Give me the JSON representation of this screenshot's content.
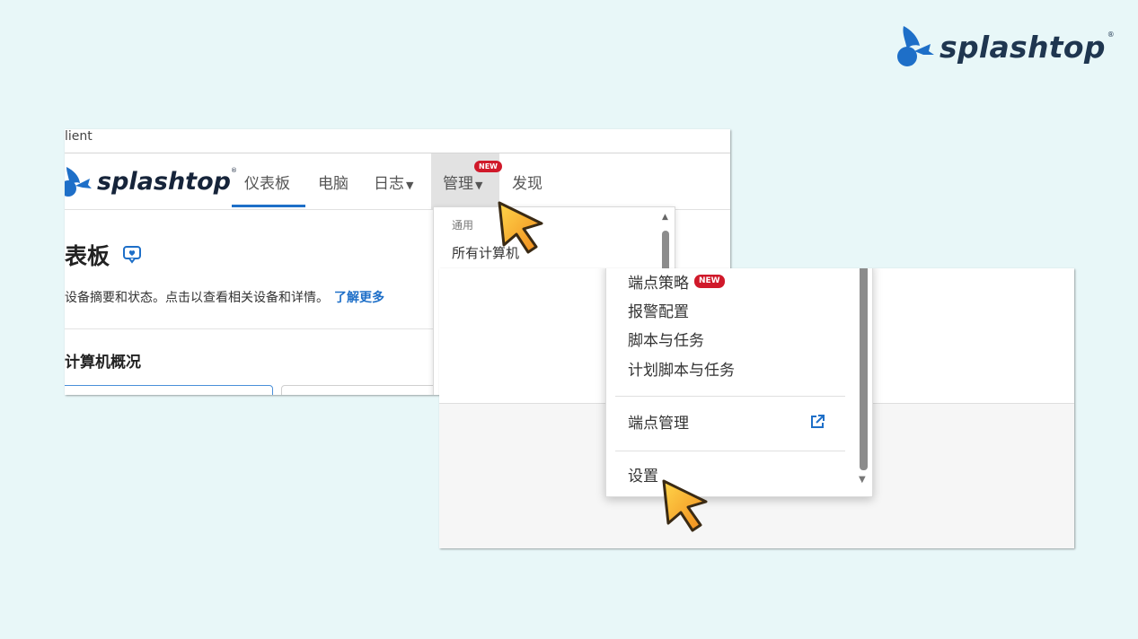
{
  "brand": {
    "name": "splashtop",
    "reg": "®"
  },
  "shot1": {
    "window_title": "lient",
    "nav": {
      "logo_text": "splashtop",
      "logo_reg": "®",
      "items": [
        {
          "label": "仪表板"
        },
        {
          "label": "电脑"
        },
        {
          "label": "日志"
        },
        {
          "label": "管理"
        },
        {
          "label": "发现"
        }
      ],
      "new_badge": "NEW"
    },
    "page": {
      "title": "表板",
      "description": "设备摘要和状态。点击以查看相关设备和详情。",
      "learn_more": "了解更多",
      "section_title": "计算机概况"
    },
    "dropdown": {
      "group_label": "通用",
      "items": [
        "所有计算机"
      ]
    }
  },
  "shot2": {
    "menu": {
      "items": [
        {
          "label": "端点策略",
          "badge": "NEW"
        },
        {
          "label": "报警配置"
        },
        {
          "label": "脚本与任务"
        },
        {
          "label": "计划脚本与任务"
        },
        {
          "label": "端点管理"
        },
        {
          "label": "设置"
        }
      ]
    }
  },
  "colors": {
    "accent": "#1e6fc8",
    "badge": "#d0192a",
    "background": "#e8f7f8",
    "cursor": "#f5a623"
  },
  "icons": [
    "splashtop-logo",
    "chat-heart-icon",
    "external-link-icon",
    "cursor-arrow-icon",
    "caret-down-icon"
  ]
}
